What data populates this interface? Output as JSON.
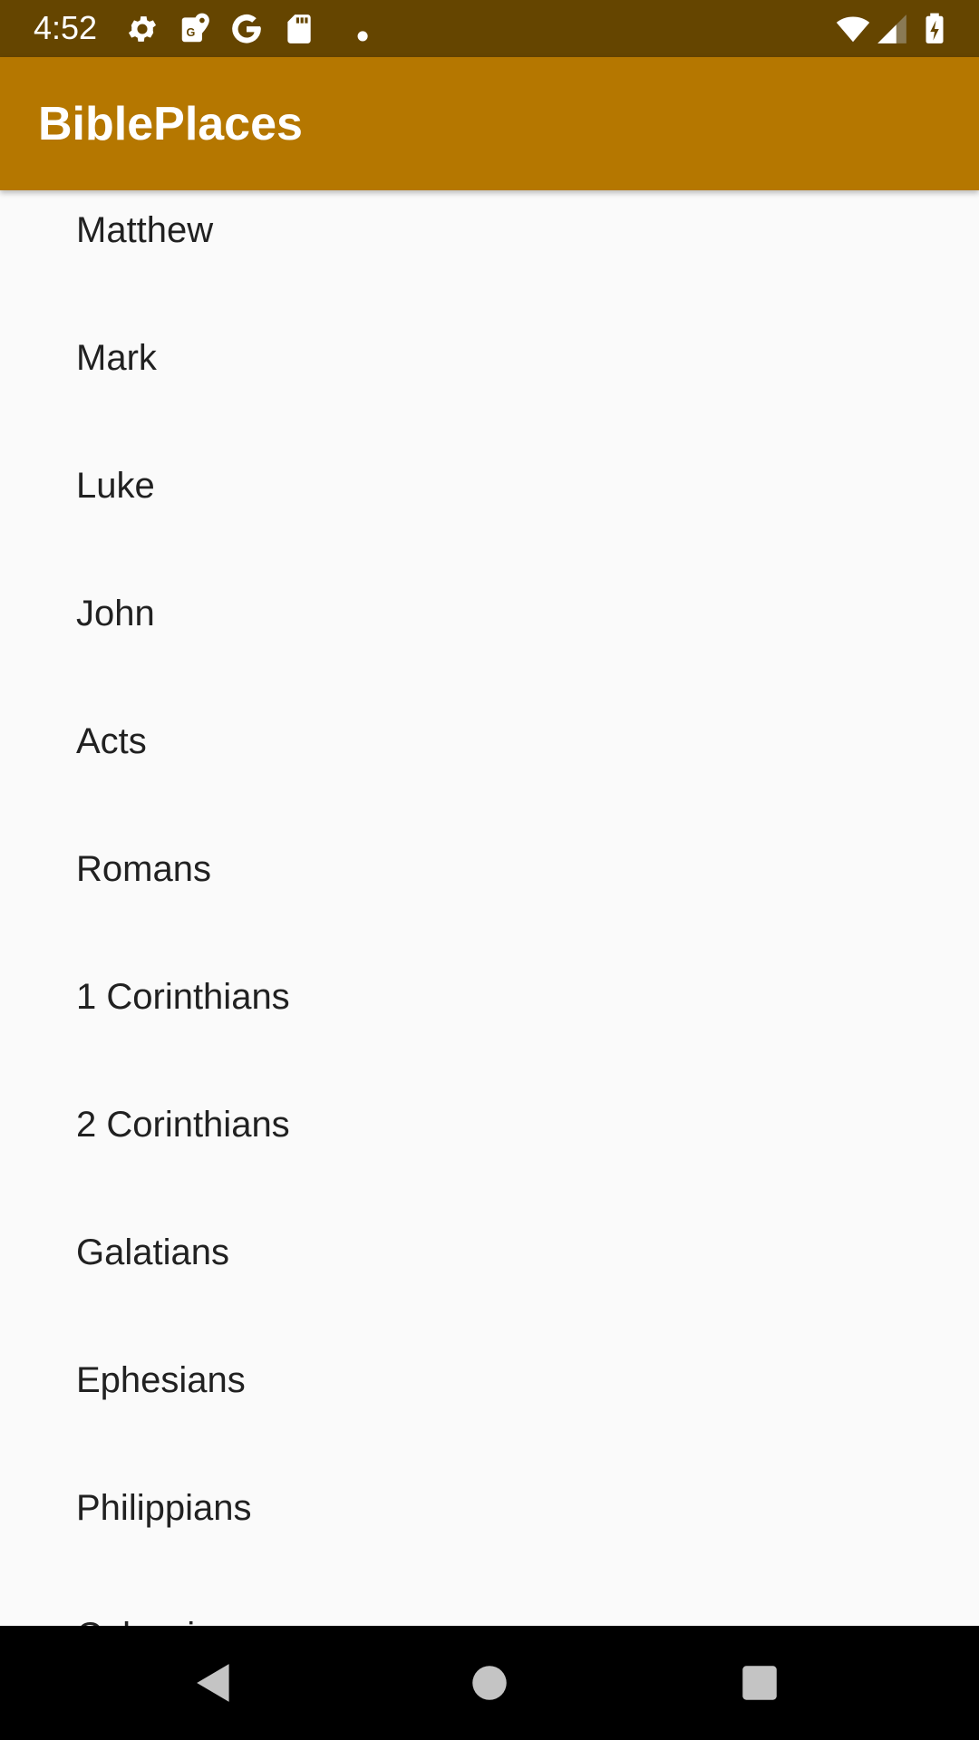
{
  "status_bar": {
    "time": "4:52",
    "icons": [
      "gear-icon",
      "maps-icon",
      "google-icon",
      "sd-card-icon",
      "dot-icon",
      "wifi-icon",
      "cell-signal-icon",
      "battery-icon"
    ]
  },
  "app_bar": {
    "title": "BiblePlaces"
  },
  "books": [
    "Matthew",
    "Mark",
    "Luke",
    "John",
    "Acts",
    "Romans",
    "1 Corinthians",
    "2 Corinthians",
    "Galatians",
    "Ephesians",
    "Philippians",
    "Colossians"
  ],
  "nav_bar": {
    "buttons": [
      "back-button",
      "home-button",
      "recents-button"
    ]
  },
  "colors": {
    "status_bar": "#654500",
    "app_bar": "#b57700",
    "background": "#fafafa",
    "list_text": "#212121",
    "nav_bar": "#000000"
  }
}
